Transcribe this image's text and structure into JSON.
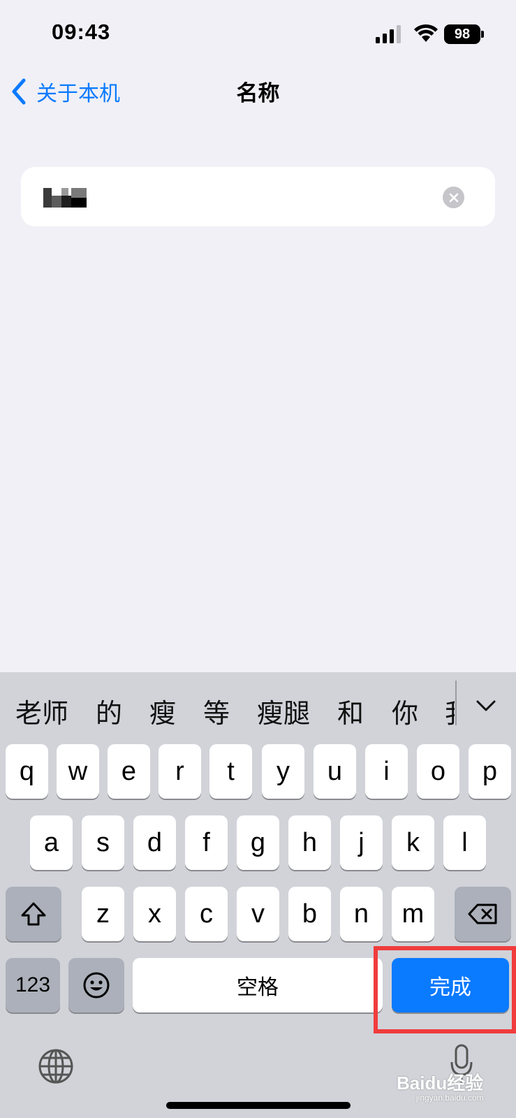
{
  "status_bar": {
    "time": "09:43",
    "battery": "98",
    "icons": [
      "cellular-signal-icon",
      "wifi-icon",
      "battery-icon"
    ]
  },
  "nav": {
    "back_label": "关于本机",
    "title": "名称"
  },
  "name_field": {
    "value": "",
    "value_redacted": true,
    "clear_icon": "clear-icon"
  },
  "keyboard": {
    "candidates": [
      "老师",
      "的",
      "瘦",
      "等",
      "瘦腿",
      "和",
      "你",
      "我"
    ],
    "row1": [
      "q",
      "w",
      "e",
      "r",
      "t",
      "y",
      "u",
      "i",
      "o",
      "p"
    ],
    "row2": [
      "a",
      "s",
      "d",
      "f",
      "g",
      "h",
      "j",
      "k",
      "l"
    ],
    "row3": [
      "z",
      "x",
      "c",
      "v",
      "b",
      "n",
      "m"
    ],
    "num_label": "123",
    "space_label": "空格",
    "done_label": "完成",
    "icons": [
      "chevron-down-icon",
      "shift-icon",
      "delete-icon",
      "emoji-icon",
      "globe-icon",
      "microphone-icon"
    ]
  },
  "colors": {
    "accent": "#0a7aff",
    "highlight": "#f03c3c",
    "background": "#f0f0f6",
    "keyboard_bg": "#d1d3d9"
  },
  "watermark": {
    "logo_text": "Baidu经验",
    "url": "jingyan.baidu.com"
  }
}
